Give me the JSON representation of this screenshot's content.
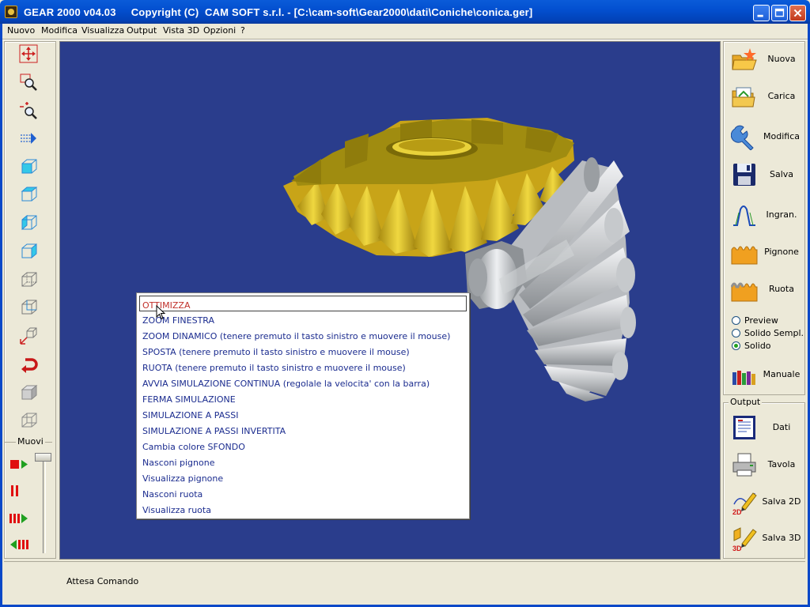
{
  "window": {
    "title": "GEAR 2000 v04.03     Copyright (C)  CAM SOFT s.r.l. - [C:\\cam-soft\\Gear2000\\dati\\Coniche\\conica.ger]"
  },
  "menubar": [
    "Nuovo",
    "Modifica",
    "Visualizza",
    "Output",
    "Vista 3D",
    "Opzioni",
    "?"
  ],
  "left_toolbar": {
    "tools": [
      "move-view-icon",
      "zoom-window-icon",
      "zoom-dynamic-icon",
      "pan-arrow-icon",
      "view-cube-front-icon",
      "view-cube-top-icon",
      "view-cube-side-icon",
      "view-cube-iso-icon",
      "view-cube-wire-icon",
      "view-cube-back-icon",
      "rotate-axes-icon",
      "undo-rotate-icon",
      "solid-cube-icon",
      "wire-cube-icon"
    ],
    "muovi_label": "Muovi",
    "muovi_tools": [
      "stop-play-icon",
      "pause-icon",
      "step-forward-icon",
      "step-backward-icon"
    ]
  },
  "context_menu": {
    "items": [
      "OTTIMIZZA",
      "ZOOM FINESTRA",
      "ZOOM DINAMICO (tenere premuto il tasto sinistro e muovere il mouse)",
      "SPOSTA (tenere premuto il tasto sinistro e muovere il mouse)",
      "RUOTA (tenere premuto il tasto sinistro e muovere il mouse)",
      "AVVIA SIMULAZIONE CONTINUA (regolale la velocita' con la barra)",
      "FERMA SIMULAZIONE",
      "SIMULAZIONE A PASSI",
      "SIMULAZIONE A PASSI INVERTITA",
      "Cambia colore SFONDO",
      "Nasconi pignone",
      "Visualizza pignone",
      "Nasconi ruota",
      "Visualizza ruota"
    ],
    "selected_index": 0
  },
  "right_panel": {
    "buttons": [
      "Nuova",
      "Carica",
      "Modifica",
      "Salva",
      "Ingran.",
      "Pignone",
      "Ruota"
    ],
    "radios": [
      {
        "label": "Preview",
        "checked": false
      },
      {
        "label": "Solido Sempl.",
        "checked": false
      },
      {
        "label": "Solido",
        "checked": true
      }
    ],
    "manual_label": "Manuale",
    "output_label": "Output",
    "output_buttons": [
      "Dati",
      "Tavola",
      "Salva 2D",
      "Salva 3D"
    ]
  },
  "status": {
    "text": "Attesa Comando"
  },
  "colors": {
    "viewport_bg": "#2a3d8c",
    "gear_gold": "#d9b81e",
    "gear_silver": "#c8cbcf",
    "selected_item": "#c0302a",
    "menu_text": "#1b2c8f"
  }
}
